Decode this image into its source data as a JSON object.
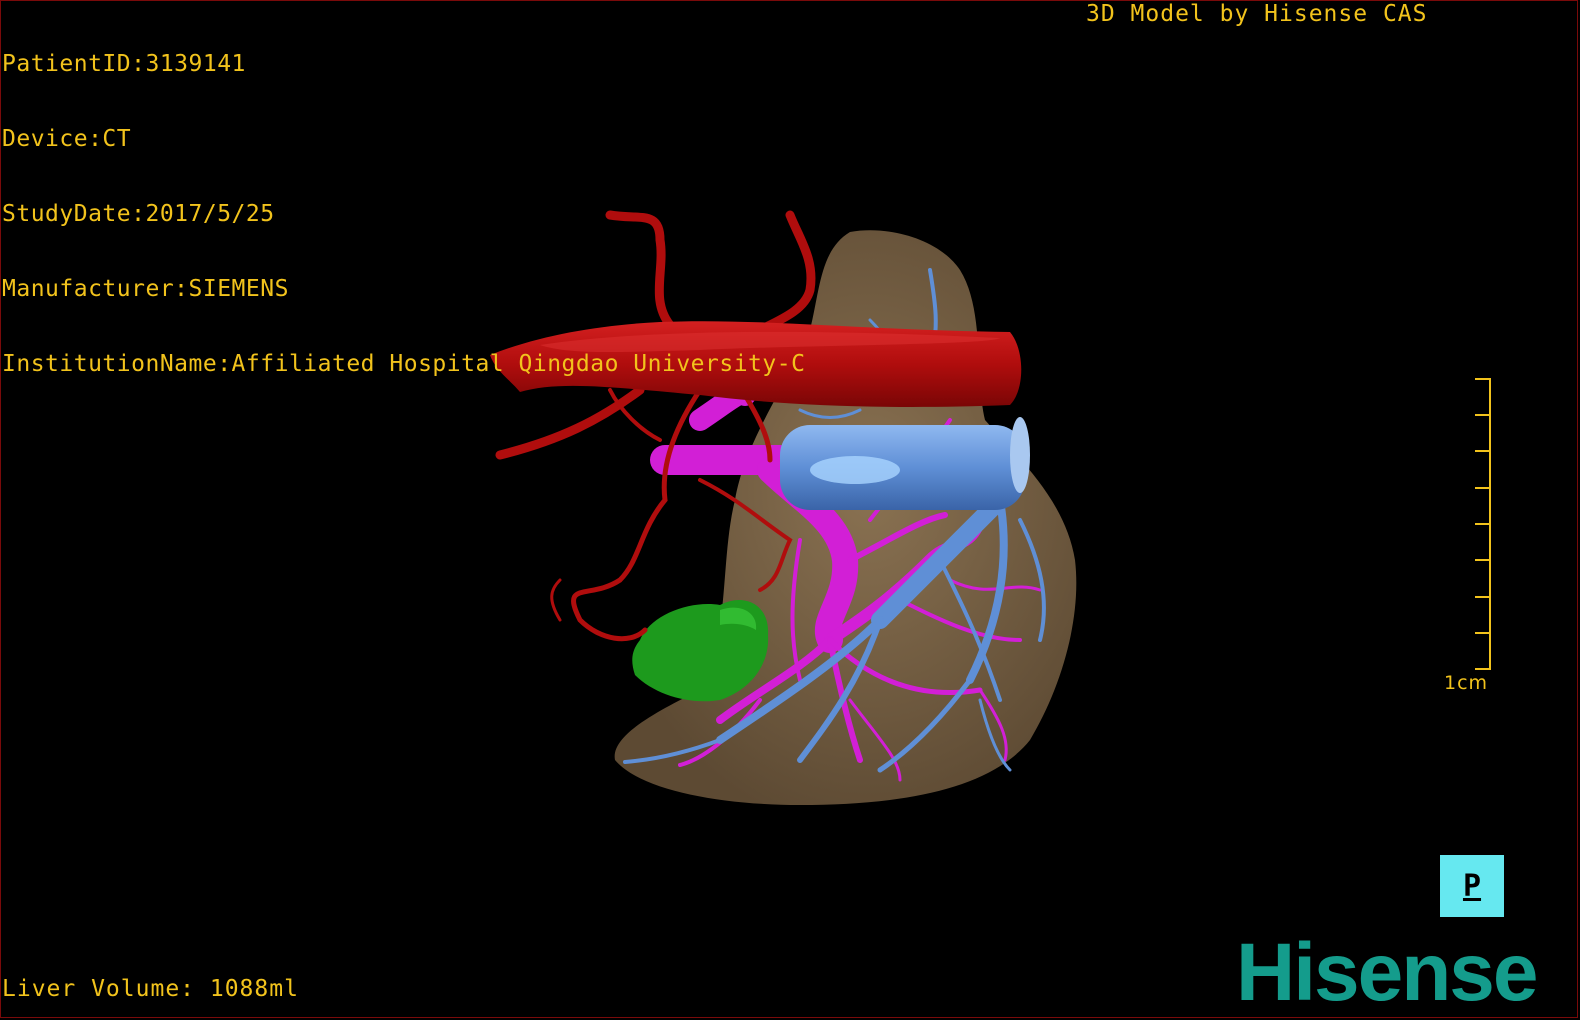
{
  "overlay": {
    "patient_id": "PatientID:3139141",
    "device": "Device:CT",
    "study_date": "StudyDate:2017/5/25",
    "manufacturer": "Manufacturer:SIEMENS",
    "institution": "InstitutionName:Affiliated Hospital Qingdao University-C",
    "credit": "3D Model by Hisense CAS",
    "liver_volume": "Liver Volume: 1088ml"
  },
  "scale_bar": {
    "label": "1cm"
  },
  "orientation": {
    "label": "P"
  },
  "brand": {
    "logo_text": "Hisense"
  },
  "colors": {
    "overlay_text": "#f2c31c",
    "liver": "#7a6448",
    "artery": "#c01010",
    "portal_vein": "#d21fd6",
    "hepatic_vein": "#5f8fd6",
    "lesion": "#1d9a1d",
    "orientation_cube": "#66e8f0",
    "brand": "#149c8c"
  },
  "legend_icons": [
    "liver-model",
    "artery-icon",
    "portal-vein-icon",
    "hepatic-vein-icon",
    "lesion-icon"
  ]
}
